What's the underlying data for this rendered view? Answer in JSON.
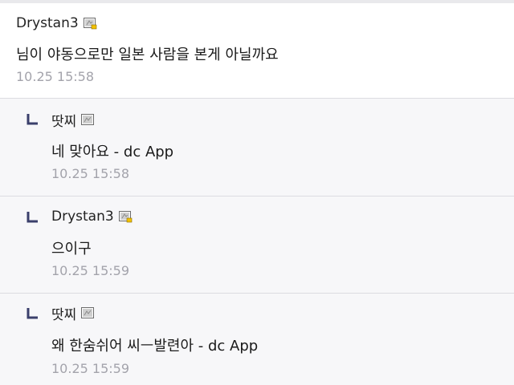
{
  "comments": [
    {
      "nickname": "Drystan3",
      "icon": "fixed-member-icon",
      "text": "님이 야동으로만 일본 사람을 본게 아닐까요",
      "time": "10.25 15:58"
    },
    {
      "nickname": "땃찌",
      "icon": "half-fixed-member-icon",
      "text": "네 맞아요 - dc App",
      "time": "10.25 15:58"
    },
    {
      "nickname": "Drystan3",
      "icon": "fixed-member-icon",
      "text": "으이구",
      "time": "10.25 15:59"
    },
    {
      "nickname": "땃찌",
      "icon": "half-fixed-member-icon",
      "text": "왜 한숨쉬어 씨ㅡ발련아 - dc App",
      "time": "10.25 15:59"
    }
  ],
  "colors": {
    "time": "#a3a3ab",
    "reply_bg": "#f7f7f9",
    "separator": "#dcdce1",
    "reply_arrow": "#3a3f6b"
  }
}
